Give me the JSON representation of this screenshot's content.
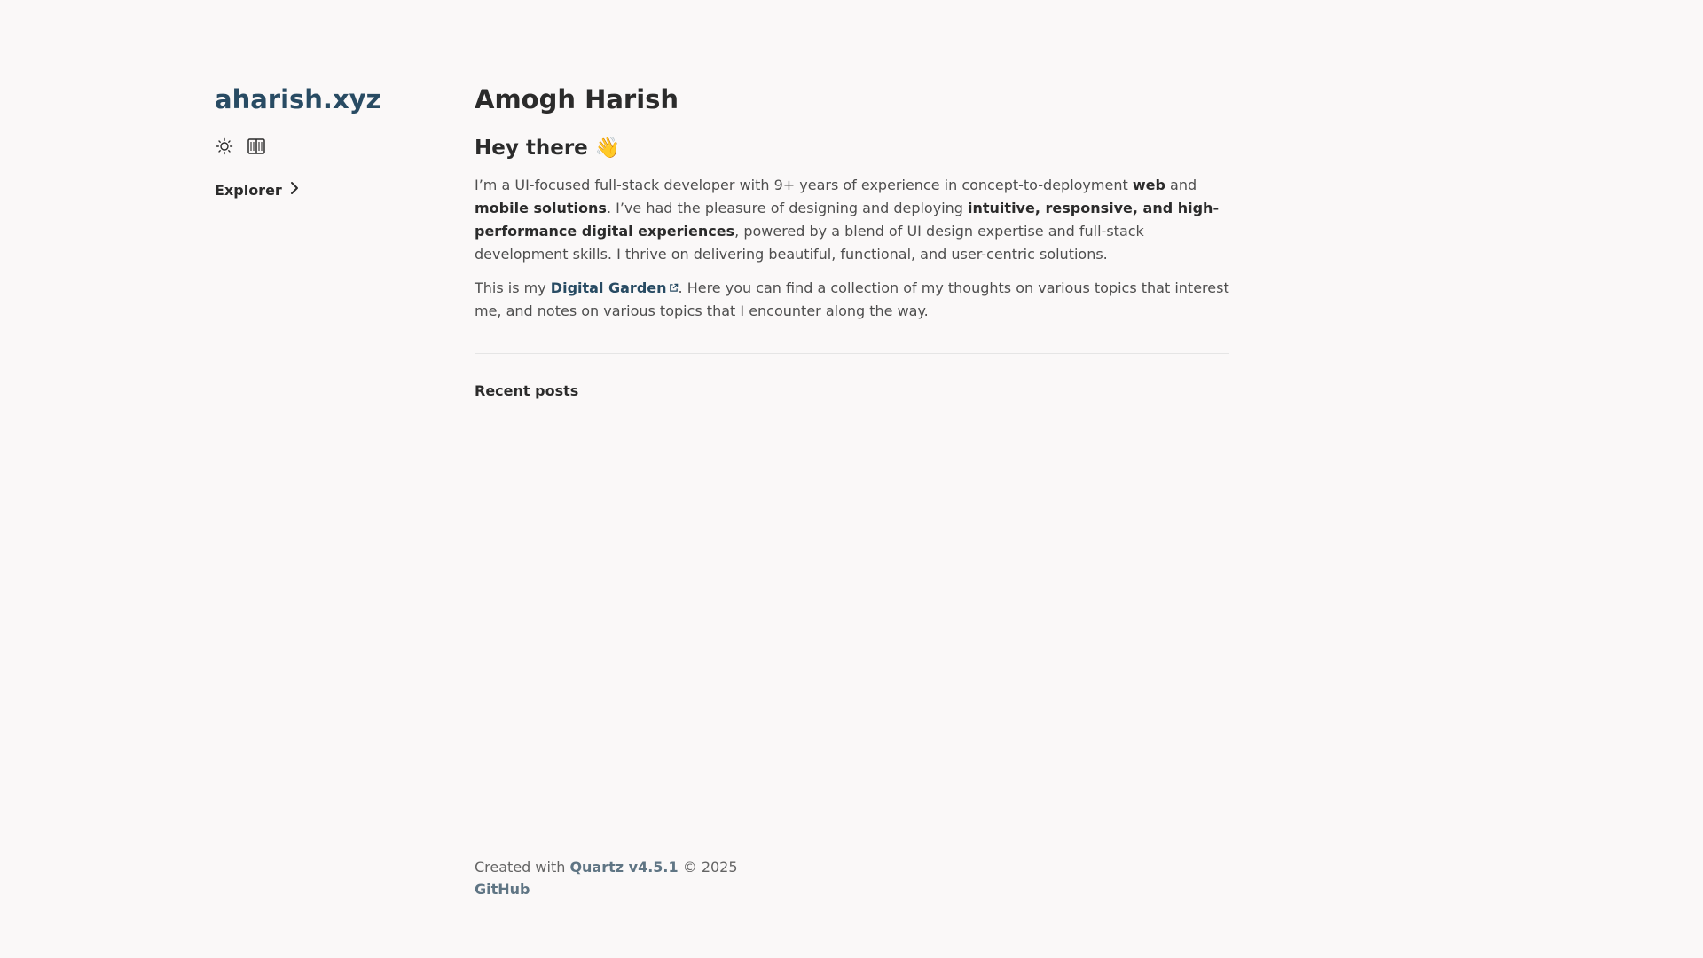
{
  "sidebar": {
    "site_title": "aharish.xyz",
    "toolbar": {
      "darkmode_icon": "sun-icon",
      "reader_icon": "book-icon"
    },
    "explorer_label": "Explorer",
    "explorer_icon": "chevron-right-icon"
  },
  "main": {
    "page_title": "Amogh Harish",
    "greeting": "Hey there 👋",
    "intro": {
      "t1": "I’m a UI-focused full-stack developer with 9+ years of experience in concept-to-deployment ",
      "b1": "web",
      "t2": " and ",
      "b2": "mobile solutions",
      "t3": ". I’ve had the pleasure of designing and deploying ",
      "b3": "intuitive, responsive, and high-performance digital experiences",
      "t4": ", powered by a blend of UI design expertise and full-stack development skills. I thrive on delivering beautiful, functional, and user-centric solutions."
    },
    "garden": {
      "t1": "This is my ",
      "link": "Digital Garden",
      "t2": ". Here you can find a collection of my thoughts on various topics that interest me, and notes on various topics that I encounter along the way."
    },
    "recent_heading": "Recent posts"
  },
  "footer": {
    "created_with": "Created with ",
    "quartz_link": "Quartz v4.5.1",
    "copyright": " © 2025",
    "github_link": "GitHub"
  },
  "colors": {
    "background": "#faf8f8",
    "accent": "#284b63",
    "text": "#4e4e4e",
    "heading": "#2b2b2b"
  }
}
